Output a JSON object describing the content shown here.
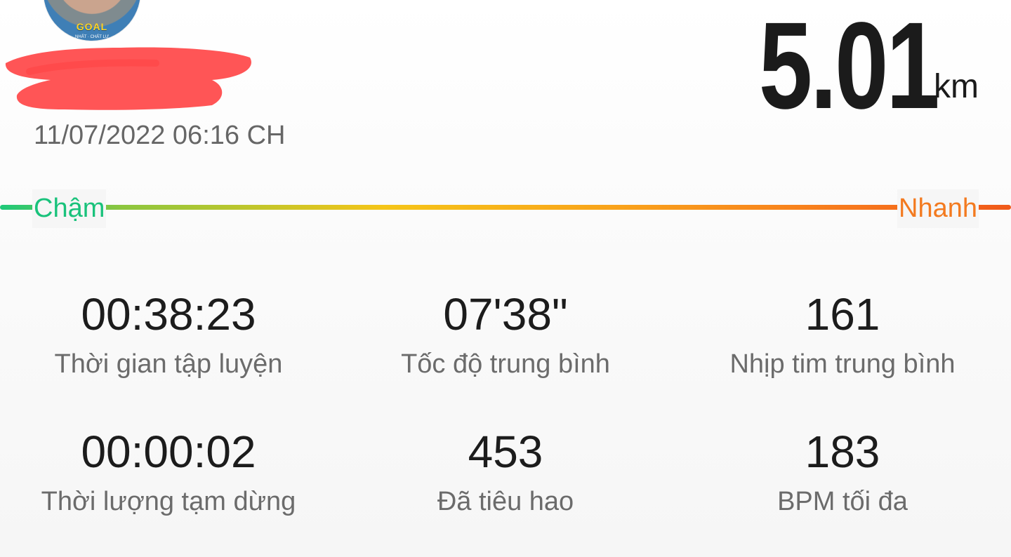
{
  "header": {
    "avatar_logo": "GOAL",
    "avatar_sub": "NHẤT · CHẤT LƯ",
    "date": "11/07/2022 06:16 CH"
  },
  "distance": {
    "value": "5.01",
    "unit": "km"
  },
  "speed_scale": {
    "slow_label": "Chậm",
    "fast_label": "Nhanh",
    "colors": {
      "slow": "#19c27b",
      "fast": "#f37a1f"
    }
  },
  "stats": [
    {
      "value": "00:38:23",
      "label": "Thời gian tập luyện"
    },
    {
      "value": "07'38\"",
      "label": "Tốc độ trung bình"
    },
    {
      "value": "161",
      "label": "Nhịp tim trung bình"
    },
    {
      "value": "00:00:02",
      "label": "Thời lượng tạm dừng"
    },
    {
      "value": "453",
      "label": "Đã tiêu hao"
    },
    {
      "value": "183",
      "label": "BPM tối đa"
    }
  ]
}
